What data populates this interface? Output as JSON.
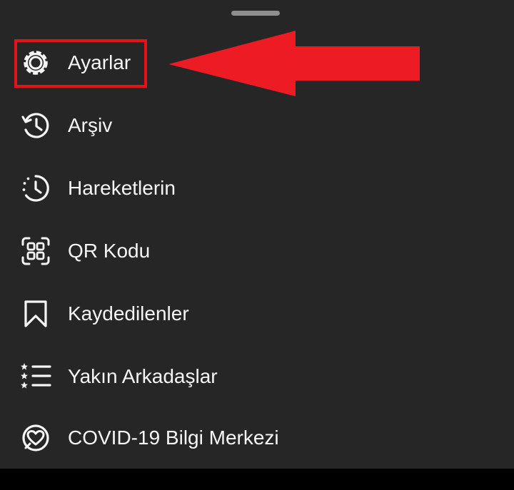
{
  "sheet": {
    "menu_items": [
      {
        "label": "Ayarlar",
        "icon": "gear-icon"
      },
      {
        "label": "Arşiv",
        "icon": "archive-history-icon"
      },
      {
        "label": "Hareketlerin",
        "icon": "activity-clock-icon"
      },
      {
        "label": "QR Kodu",
        "icon": "qr-code-icon"
      },
      {
        "label": "Kaydedilenler",
        "icon": "bookmark-icon"
      },
      {
        "label": "Yakın Arkadaşlar",
        "icon": "close-friends-list-icon"
      },
      {
        "label": "COVID-19 Bilgi Merkezi",
        "icon": "heart-badge-icon"
      }
    ]
  },
  "annotation": {
    "color": "#e3121c",
    "target": "Ayarlar"
  },
  "colors": {
    "sheet_background": "#262626",
    "text": "#f5f5f5",
    "handle": "#8e8e8e"
  }
}
